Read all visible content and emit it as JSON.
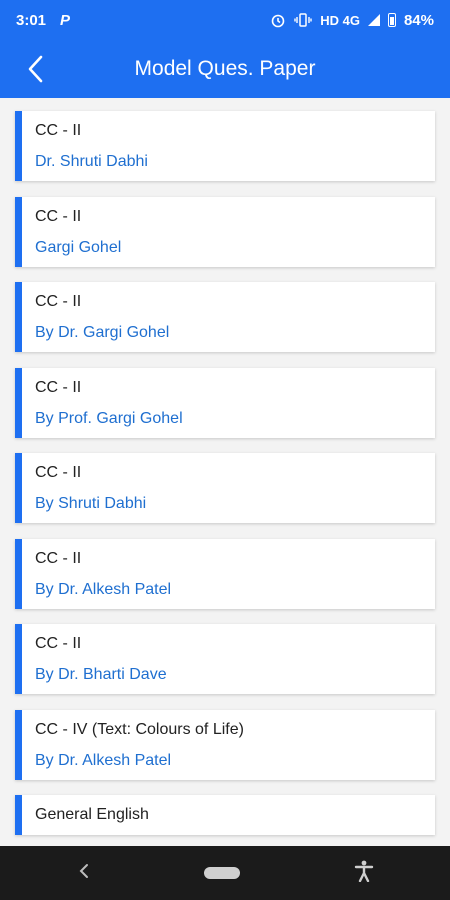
{
  "status_bar": {
    "time": "3:01",
    "app_icon": "P",
    "network": "HD 4G",
    "battery": "84%"
  },
  "app_bar": {
    "title": "Model Ques. Paper",
    "back_icon": "chevron-left-icon"
  },
  "papers": [
    {
      "title": "CC - II",
      "author": "Dr. Shruti Dabhi"
    },
    {
      "title": "CC - II",
      "author": "Gargi Gohel"
    },
    {
      "title": "CC - II",
      "author": "By Dr. Gargi Gohel"
    },
    {
      "title": "CC - II",
      "author": "By Prof. Gargi Gohel"
    },
    {
      "title": "CC - II",
      "author": "By Shruti Dabhi"
    },
    {
      "title": "CC - II",
      "author": "By Dr. Alkesh Patel"
    },
    {
      "title": "CC - II",
      "author": "By Dr. Bharti Dave"
    },
    {
      "title": "CC - IV (Text: Colours of Life)",
      "author": "By Dr. Alkesh Patel"
    },
    {
      "title": "General English",
      "author": ""
    }
  ],
  "colors": {
    "primary": "#1e6ff1",
    "author_text": "#1f6fd0",
    "nav_bar": "#1b1b1b"
  }
}
